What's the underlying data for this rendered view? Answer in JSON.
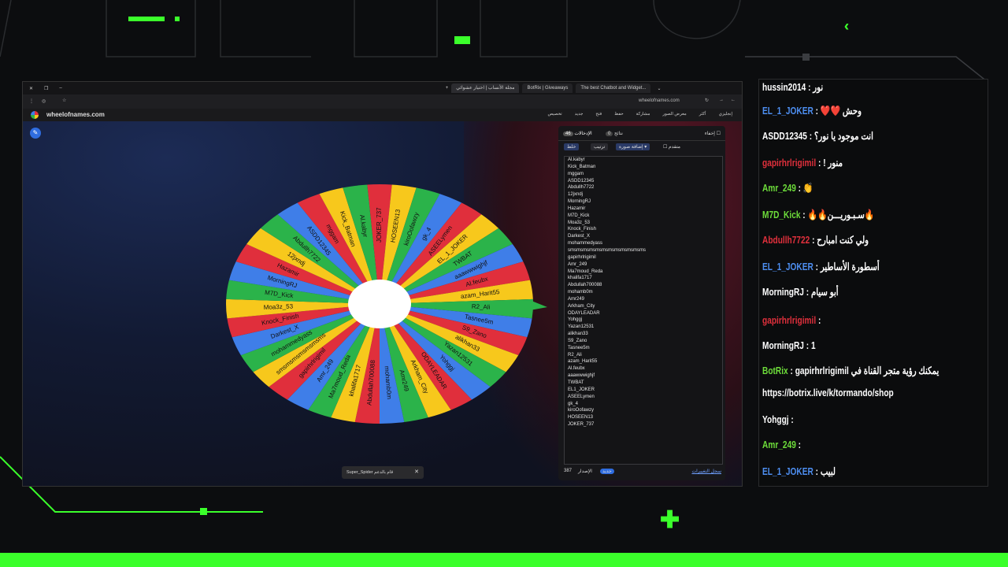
{
  "colors": {
    "green": "#3bff2b",
    "red": "#e02f3c",
    "yellow": "#f7c81c",
    "blue": "#3f7ee8",
    "wheelgreen": "#2bb34a"
  },
  "browser": {
    "tabs": [
      "مجلة الأنساب | اختيار عشوائي",
      "BotRix | Giveaways",
      "The best Chatbot and Widget..."
    ],
    "url": "wheelofnames.com",
    "site_name": "wheelofnames.com",
    "toolbar": [
      "تخصيص",
      "جديد",
      "فتح",
      "حفظ",
      "مشاركة",
      "معرض الصور",
      "أكثر",
      "إنجليزي"
    ]
  },
  "panel": {
    "tab_entries": "الإدخالات",
    "tab_entries_count": "46",
    "tab_results": "نتائج",
    "tab_results_count": "0",
    "hide": "إخفاء",
    "shuffle": "خلط",
    "sort": "ترتيب",
    "add_image": "إضافة صورة",
    "advanced": "متقدم",
    "version": "387",
    "version_label": "الإصدار",
    "badge": "جديد",
    "changelog": "سجل التغييرات"
  },
  "entries": [
    "Al.kabyr",
    "Kick_Batman",
    "mggam",
    "ASDD12345",
    "Abdullh7722",
    "12jxndj",
    "MorningRJ",
    "Hazamir",
    "M7D_Kick",
    "Moa3z_53",
    "Knock_Finish",
    "Darkest_X",
    "mohammedyass",
    "smsmsmsmsmsmsmsmsmsmsmsms",
    "gapirhrlrigimil",
    "Amr_249",
    "Ma7moud_Reda",
    "khalifa1717",
    "Abdullah700088",
    "mohamb0m",
    "Amr249",
    "Arkham_City",
    "ODAYLEADAR",
    "Yohggj",
    "Yazan12531",
    "alikhan33",
    "S9_Zano",
    "Tasnee5m",
    "R2_Ali",
    "azam_Harit55",
    "Al.feubx",
    "aaawwwighjf",
    "TWBAT",
    "EL1_JOKER",
    "ASEELymen",
    "gk_4",
    "kiroOofawzy",
    "HOSEEN13",
    "JOKER_737"
  ],
  "wheel_labels": [
    "JOKER_737",
    "HOSEEN13",
    "kiroOofawzy",
    "gk_4",
    "ASEELymen",
    "EL_1_JOKER",
    "TWBAT",
    "aaawwwighjf",
    "Al.feubx",
    "azam_Harit55",
    "R2_Ali",
    "Tasnee5m",
    "S9_Zano",
    "alikhan33",
    "Yazan12531",
    "Yohggj",
    "ODAYLEADAR",
    "Arkham_City",
    "Amr249",
    "mohamb0m",
    "Abdullah700088",
    "khalifa1717",
    "Ma7moud_Reda",
    "Amr_249",
    "gapirhrlrigimil",
    "smsmsmsmsmsmsms",
    "mohammedyass",
    "Darkest_X",
    "Knock_Finish",
    "Moa3z_53",
    "M7D_Kick",
    "MorningRJ",
    "Hazamir",
    "12jxndj",
    "Abdullh7722",
    "ASDD12345",
    "mggam",
    "Kick_Batman",
    "Al.kabyr"
  ],
  "toast": {
    "text": "Super_Spider قام بالدعم",
    "close": "✕"
  },
  "chat": [
    {
      "user": "hussin2014",
      "sep": " : ",
      "text": "نور",
      "ucolor": "#ffffff"
    },
    {
      "user": "EL_1_JOKER",
      "sep": " : ",
      "text": "وحش ❤️❤️",
      "ucolor": "#4d8ef0"
    },
    {
      "user": "ASDD12345",
      "sep": " : ",
      "text": "انت موجود يا نور؟",
      "ucolor": "#ffffff"
    },
    {
      "user": "gapirhrlrigimil",
      "sep": " : ",
      "text": "منور !",
      "ucolor": "#e0303c"
    },
    {
      "user": "Amr_249",
      "sep": " : ",
      "text": "👏",
      "ucolor": "#6ddc3a"
    },
    {
      "user": "M7D_Kick",
      "sep": " : ",
      "text": "🔥سـبـوريـــن🔥🔥",
      "ucolor": "#6ddc3a"
    },
    {
      "user": "Abdullh7722",
      "sep": " : ",
      "text": "ولي كنت امبارح",
      "ucolor": "#e0303c"
    },
    {
      "user": "EL_1_JOKER",
      "sep": " : ",
      "text": "أسطورة الأساطير",
      "ucolor": "#4d8ef0"
    },
    {
      "user": "MorningRJ",
      "sep": " : ",
      "text": "أبو سيام",
      "ucolor": "#ffffff"
    },
    {
      "user": "gapirhrlrigimil",
      "sep": " : ",
      "text": "",
      "ucolor": "#e0303c"
    },
    {
      "user": "MorningRJ",
      "sep": " : ",
      "text": "1",
      "ucolor": "#ffffff"
    },
    {
      "user": "BotRix",
      "sep": " : ",
      "text": "gapirhrlrigimil يمكنك رؤية متجر القناة في",
      "ucolor": "#6ddc3a"
    },
    {
      "user": "",
      "sep": "",
      "text": "https://botrix.live/k/tormando/shop",
      "ucolor": "#ffffff"
    },
    {
      "user": "Yohggj",
      "sep": " : ",
      "text": "",
      "ucolor": "#ffffff"
    },
    {
      "user": "Amr_249",
      "sep": " : ",
      "text": "",
      "ucolor": "#6ddc3a"
    },
    {
      "user": "EL_1_JOKER",
      "sep": " : ",
      "text": "لبيب",
      "ucolor": "#4d8ef0"
    }
  ]
}
